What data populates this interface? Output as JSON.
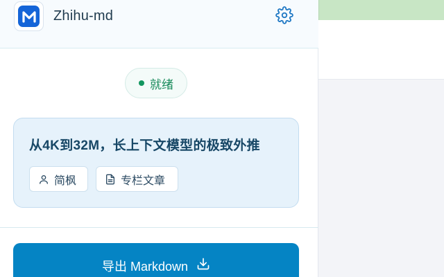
{
  "app": {
    "title": "Zhihu-md",
    "logo_letter": "M",
    "icons": {
      "logo": "markdown-logo-icon",
      "settings": "gear-icon"
    }
  },
  "status": {
    "text": "就绪",
    "color": "#12965f"
  },
  "article": {
    "title": "从4K到32M，长上下文模型的极致外推",
    "author": "简枫",
    "type": "专栏文章",
    "icons": {
      "author": "user-icon",
      "type": "document-icon"
    }
  },
  "export": {
    "label": "导出 Markdown",
    "icon": "download-icon"
  },
  "colors": {
    "accent": "#0584c4",
    "brand": "#1565d8",
    "card_bg": "#e6f2fb"
  }
}
